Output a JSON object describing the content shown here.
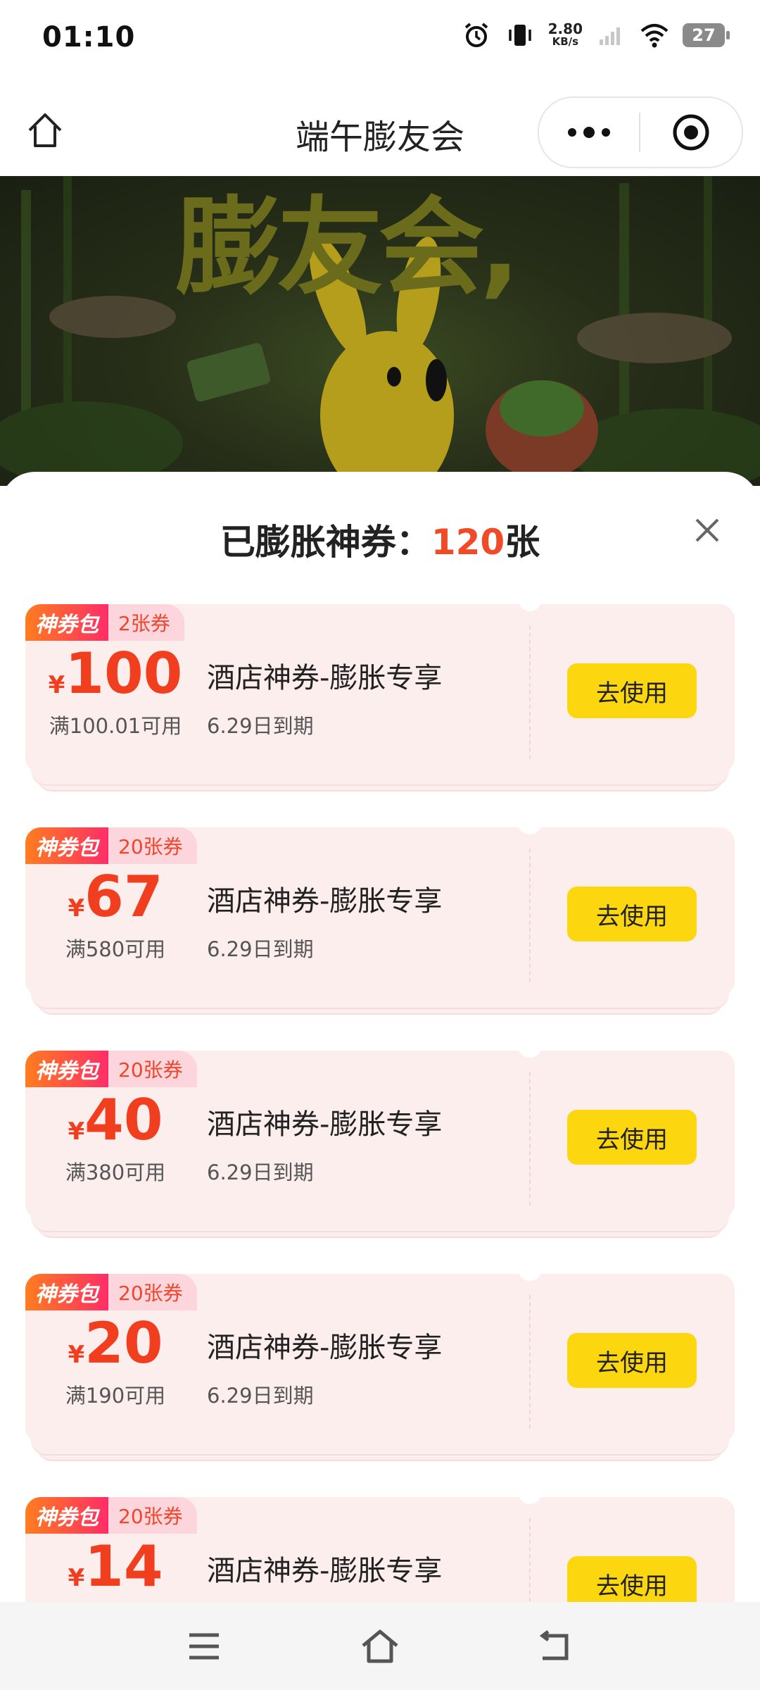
{
  "status_bar": {
    "time": "01:10",
    "net_speed_value": "2.80",
    "net_speed_unit": "KB/s",
    "battery": "27"
  },
  "nav": {
    "title": "端午膨友会"
  },
  "banner": {
    "text": "膨友会,"
  },
  "sheet": {
    "title_prefix": "已膨胀神券：",
    "count": "120",
    "title_suffix": "张"
  },
  "coupons": [
    {
      "tag": "神券包",
      "qty": "2张券",
      "currency": "¥",
      "amount": "100",
      "condition": "满100.01可用",
      "name": "酒店神券-膨胀专享",
      "expire": "6.29日到期",
      "button": "去使用"
    },
    {
      "tag": "神券包",
      "qty": "20张券",
      "currency": "¥",
      "amount": "67",
      "condition": "满580可用",
      "name": "酒店神券-膨胀专享",
      "expire": "6.29日到期",
      "button": "去使用"
    },
    {
      "tag": "神券包",
      "qty": "20张券",
      "currency": "¥",
      "amount": "40",
      "condition": "满380可用",
      "name": "酒店神券-膨胀专享",
      "expire": "6.29日到期",
      "button": "去使用"
    },
    {
      "tag": "神券包",
      "qty": "20张券",
      "currency": "¥",
      "amount": "20",
      "condition": "满190可用",
      "name": "酒店神券-膨胀专享",
      "expire": "6.29日到期",
      "button": "去使用"
    },
    {
      "tag": "神券包",
      "qty": "20张券",
      "currency": "¥",
      "amount": "14",
      "condition": "",
      "name": "酒店神券-膨胀专享",
      "expire": "",
      "button": "去使用"
    }
  ],
  "colors": {
    "accent": "#f04a26",
    "button": "#fcd60f",
    "card_bg": "#fdeeee"
  },
  "icons": [
    "alarm-icon",
    "vibrate-icon",
    "signal-icon",
    "wifi-icon",
    "battery-icon",
    "home-icon",
    "more-icon",
    "target-icon",
    "close-icon",
    "menu-icon",
    "nav-home-icon",
    "back-icon"
  ]
}
